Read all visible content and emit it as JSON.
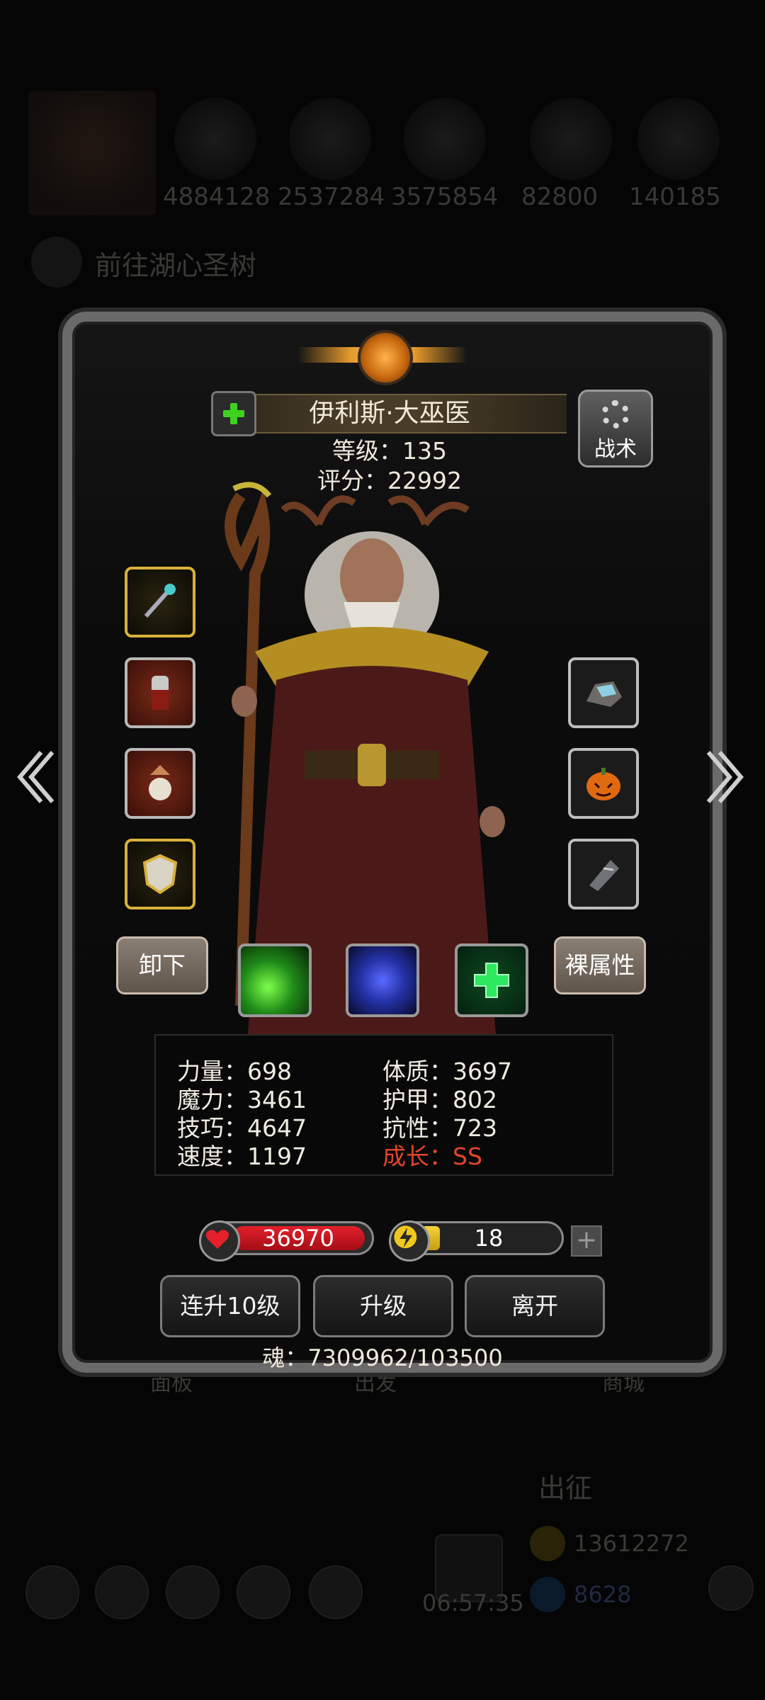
{
  "background": {
    "resources": [
      "4884128",
      "2537284",
      "3575854",
      "82800",
      "140185"
    ],
    "quest_text": "前往湖心圣树",
    "bottom_tab_labels": [
      "面板",
      "出发",
      "商城"
    ],
    "sortie_label": "出征",
    "timer": "06:57:35",
    "gold_amount": "13612272",
    "gem_amount": "8628"
  },
  "hero": {
    "name": "伊利斯·大巫医",
    "level_text": "等级：135",
    "score_text": "评分：22992",
    "tactics_label": "战术"
  },
  "equipment_left": [
    {
      "icon": "staff-icon",
      "frame": "gold"
    },
    {
      "icon": "amulet-icon",
      "frame": "red"
    },
    {
      "icon": "medal-icon",
      "frame": "red"
    },
    {
      "icon": "shield-icon",
      "frame": "gold"
    }
  ],
  "equipment_right": [
    {
      "icon": "ore-icon"
    },
    {
      "icon": "pumpkin-icon"
    },
    {
      "icon": "bracer-icon"
    }
  ],
  "buttons": {
    "unequip": "卸下",
    "base_attributes": "裸属性",
    "level_up_10": "连升10级",
    "level_up": "升级",
    "leave": "离开"
  },
  "skills": [
    {
      "icon": "green-claw-skill-icon",
      "color": "#1f8a18"
    },
    {
      "icon": "blue-shadow-skill-icon",
      "color": "#2432a8"
    },
    {
      "icon": "green-heal-skill-icon",
      "color": "#11b84a"
    }
  ],
  "stats": {
    "strength": "力量：698",
    "constitution": "体质：3697",
    "magic": "魔力：3461",
    "armor": "护甲：802",
    "skill": "技巧：4647",
    "resistance": "抗性：723",
    "speed": "速度：1197",
    "growth": "成长：SS"
  },
  "bars": {
    "hp_value": "36970",
    "energy_value": "18"
  },
  "soul_text": "魂：7309962/103500",
  "colors": {
    "hp": "#d8161f",
    "energy": "#f0c71e",
    "growth": "#e2452a",
    "heal_plus": "#3ed21e"
  }
}
